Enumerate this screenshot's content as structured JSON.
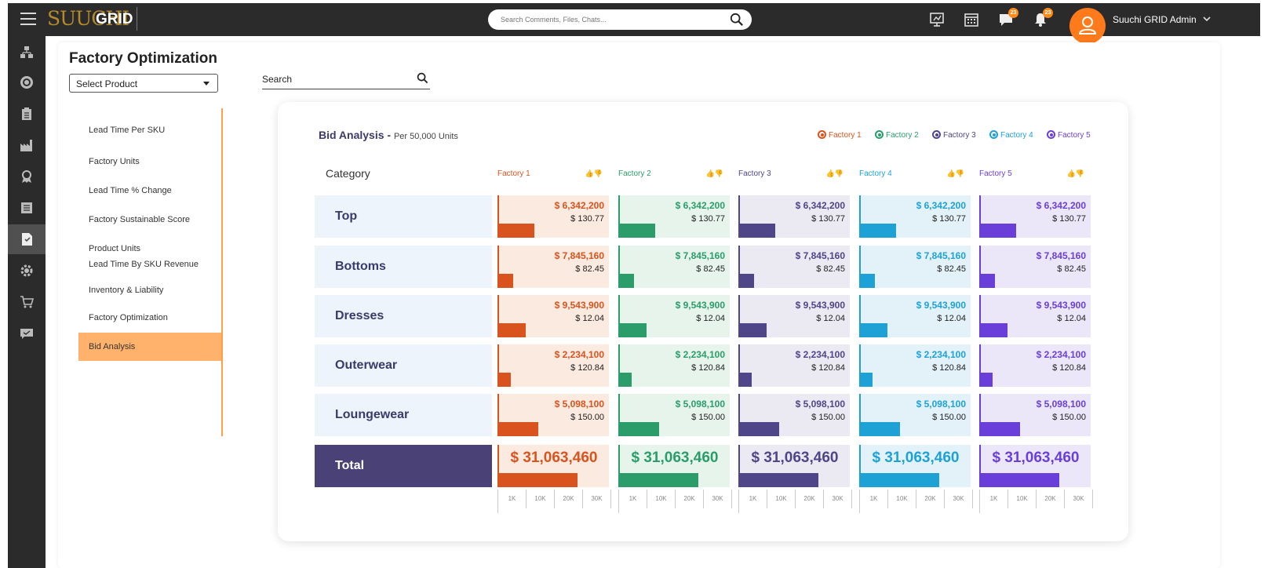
{
  "app": {
    "brand_mark": "SUUCHI",
    "title": "GRID"
  },
  "search": {
    "placeholder": "Search Comments, Files, Chats..."
  },
  "notifications": {
    "chat_count": "23",
    "alert_count": "23"
  },
  "user": {
    "name": "Suuchi GRID Admin"
  },
  "page": {
    "title": "Factory Optimization",
    "select_product": "Select Product",
    "search_label": "Search"
  },
  "subnav": [
    "Lead Time Per SKU",
    "Factory Units",
    "Lead Time % Change",
    "Factory Sustainable Score",
    "Product Units",
    "Lead Time By SKU Revenue",
    "Inventory & Liability",
    "Factory Optimization",
    "Bid Analysis"
  ],
  "bid": {
    "title": "Bid Analysis - ",
    "subtitle": "Per 50,000 Units",
    "category_header": "Category",
    "total_label": "Total",
    "thumbs": "👍👎",
    "factories": [
      {
        "name": "Factory 1",
        "color": "#d9531e",
        "bg": "#fbeae0"
      },
      {
        "name": "Factory 2",
        "color": "#2a9d6a",
        "bg": "#e6f4ec"
      },
      {
        "name": "Factory 3",
        "color": "#4f4589",
        "bg": "#ebe9f2"
      },
      {
        "name": "Factory 4",
        "color": "#1ea2d6",
        "bg": "#e3f1f8"
      },
      {
        "name": "Factory 5",
        "color": "#6a3fd9",
        "bg": "#ece7f8"
      }
    ],
    "rows": [
      {
        "category": "Top",
        "total_value": "$ 6,342,200",
        "unit_price": "$ 130.77",
        "level": 0.37
      },
      {
        "category": "Bottoms",
        "total_value": "$ 7,845,160",
        "unit_price": "$ 82.45",
        "level": 0.15
      },
      {
        "category": "Dresses",
        "total_value": "$ 9,543,900",
        "unit_price": "$ 12.04",
        "level": 0.28
      },
      {
        "category": "Outerwear",
        "total_value": "$ 2,234,100",
        "unit_price": "$ 120.84",
        "level": 0.12
      },
      {
        "category": "Loungewear",
        "total_value": "$ 5,098,100",
        "unit_price": "$ 150.00",
        "level": 0.41
      }
    ],
    "total_value": "$ 31,063,460",
    "total_level": 0.82,
    "axis_ticks": [
      "1K",
      "10K",
      "20K",
      "30K"
    ]
  }
}
